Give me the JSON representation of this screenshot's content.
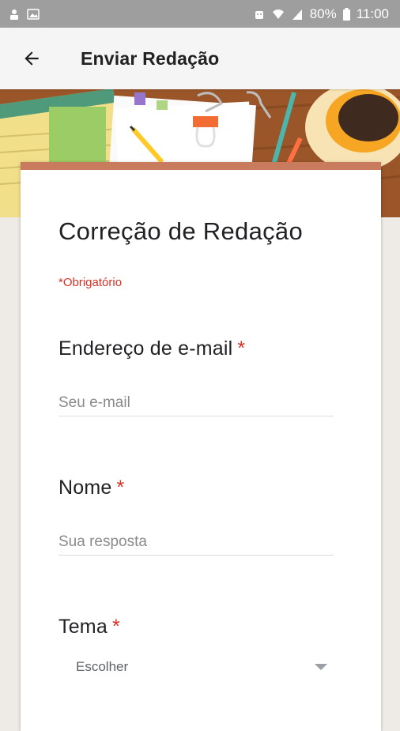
{
  "status_bar": {
    "battery": "80%",
    "time": "11:00"
  },
  "app_bar": {
    "title": "Enviar Redação"
  },
  "form": {
    "title": "Correção de Redação",
    "required_note": "*Obrigatório",
    "questions": [
      {
        "label": "Endereço de e-mail",
        "required_mark": "*",
        "placeholder": "Seu e-mail",
        "value": ""
      },
      {
        "label": "Nome",
        "required_mark": "*",
        "placeholder": "Sua resposta",
        "value": ""
      },
      {
        "label": "Tema",
        "required_mark": "*",
        "selected": "Escolher"
      }
    ]
  },
  "colors": {
    "accent": "#c97c5d",
    "required": "#d93025",
    "app_bar_bg": "#f5f5f5",
    "status_bar_bg": "#9e9e9e"
  }
}
